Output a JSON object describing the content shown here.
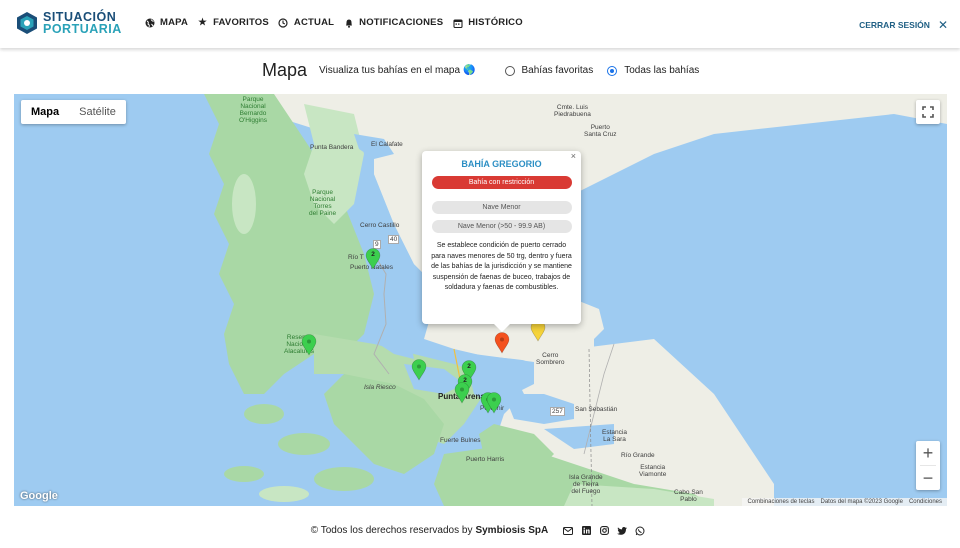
{
  "brand": {
    "line1": "SITUACIÓN",
    "line2": "PORTUARIA"
  },
  "nav": {
    "items": [
      {
        "label": "MAPA",
        "icon": "globe-icon"
      },
      {
        "label": "FAVORITOS",
        "icon": "star-icon"
      },
      {
        "label": "ACTUAL",
        "icon": "clock-refresh-icon"
      },
      {
        "label": "NOTIFICACIONES",
        "icon": "bell-icon"
      },
      {
        "label": "HISTÓRICO",
        "icon": "calendar-icon"
      }
    ],
    "logout": "CERRAR SESIÓN"
  },
  "header": {
    "title": "Mapa",
    "subtitle": "Visualiza tus bahías en el mapa",
    "globe": "🌎",
    "filter_options": [
      {
        "label": "Bahías favoritas",
        "selected": false
      },
      {
        "label": "Todas las bahías",
        "selected": true
      }
    ]
  },
  "map": {
    "type_buttons": {
      "map": "Mapa",
      "satellite": "Satélite"
    },
    "fullscreen_icon": "fullscreen-icon",
    "zoom_in": "+",
    "zoom_out": "−",
    "google": "Google",
    "attribution": {
      "shortcuts": "Combinaciones de teclas",
      "data": "Datos del mapa ©2023 Google",
      "terms": "Condiciones"
    },
    "places": {
      "o_higgins": "Parque\nNacional\nBernardo\nO'Higgins",
      "cmte_luis": "Cmte. Luis\nPiedrabuena",
      "pto_santa_cruz": "Puerto\nSanta Cruz",
      "punta_bandera": "Punta Bandera",
      "el_calafate": "El Calafate",
      "torres": "Parque\nNacional\nTorres\ndel Paine",
      "cerro_castillo": "Cerro Castillo",
      "rio_turbio": "Río T",
      "puerto_natales": "Puerto Natales",
      "alacalufes": "Reserva\nNacional\nAlacalufes",
      "isla_riesco": "Isla Riesco",
      "punta_arenas": "Punta Arenas",
      "porvenir": "Porvenir",
      "cerro_sombrero": "Cerro\nSombrero",
      "san_sebastian": "San Sebastián",
      "estancia_la_sara": "Estancia\nLa Sara",
      "rio_grande": "Río Grande",
      "estancia_viamonte": "Estancia\nViamonte",
      "fuerte_bulnes": "Fuerte Bulnes",
      "puerto_harris": "Puerto Harris",
      "isla_grande": "Isla Grande\nde Tierra\ndel Fuego",
      "cabo_san_pablo": "Cabo San\nPablo",
      "road_9": "9",
      "road_40": "40",
      "road_257": "257"
    },
    "markers": [
      {
        "kind": "cluster",
        "color": "#3ccf4e",
        "count": "2"
      },
      {
        "kind": "single",
        "color": "#3ccf4e",
        "count": ""
      },
      {
        "kind": "single",
        "color": "#3ccf4e",
        "count": ""
      },
      {
        "kind": "cluster",
        "color": "#3ccf4e",
        "count": "2"
      },
      {
        "kind": "cluster",
        "color": "#3ccf4e",
        "count": "2"
      },
      {
        "kind": "single",
        "color": "#3ccf4e",
        "count": ""
      },
      {
        "kind": "single",
        "color": "#3ccf4e",
        "count": ""
      },
      {
        "kind": "single",
        "color": "#3ccf4e",
        "count": ""
      },
      {
        "kind": "single",
        "color": "#f4511e",
        "count": ""
      },
      {
        "kind": "single",
        "color": "#f6d33a",
        "count": ""
      }
    ]
  },
  "popup": {
    "title": "BAHÍA GREGORIO",
    "status": "Bahía con restricción",
    "status_color": "#d93a34",
    "tag1": "Nave Menor",
    "tag2": "Nave Menor (>50 - 99.9 AB)",
    "description": "Se establece condición de puerto cerrado para naves menores de 50 trg, dentro y fuera de las bahías de la jurisdicción y se mantiene suspensión de faenas de buceo, trabajos de soldadura y faenas de combustibles.",
    "close": "×"
  },
  "footer": {
    "copyright": "© Todos los derechos reservados by",
    "company": "Symbiosis SpA",
    "socials": [
      "mail-icon",
      "linkedin-icon",
      "instagram-icon",
      "twitter-icon",
      "whatsapp-icon"
    ]
  }
}
